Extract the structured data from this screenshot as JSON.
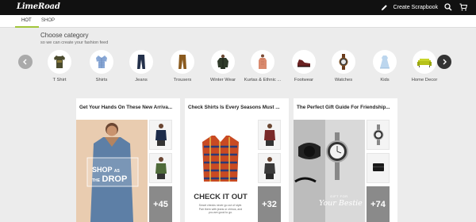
{
  "app": {
    "logo": "LimeRoad"
  },
  "topbar": {
    "create_label": "Create Scrapbook"
  },
  "tabs": [
    {
      "label": "HOT"
    },
    {
      "label": "SHOP"
    }
  ],
  "category": {
    "title": "Choose category",
    "subtitle": "so we can create your fashion feed",
    "items": [
      {
        "label": "T Shirt"
      },
      {
        "label": "Shirts"
      },
      {
        "label": "Jeans"
      },
      {
        "label": "Trousers"
      },
      {
        "label": "Winter Wear"
      },
      {
        "label": "Kurtas & Ethnic ..."
      },
      {
        "label": "Footwear"
      },
      {
        "label": "Watches"
      },
      {
        "label": "Kids"
      },
      {
        "label": "Home Decor"
      }
    ]
  },
  "cards": [
    {
      "title": "Get Your Hands On These New Arriva...",
      "main_text": "SHOP",
      "main_text2": "DROP",
      "main_small": "AS",
      "main_small2": "THE",
      "more": "+45"
    },
    {
      "title": "Check Shirts Is Every Seasons Must ...",
      "main_text": "CHECK IT OUT",
      "main_small": "Smart checks never go out of style. Pair them with jeans or chinos, and you are good to go.",
      "more": "+32"
    },
    {
      "title": "The Perfect Gift Guide For Friendship...",
      "main_text": "Your Bestie",
      "main_small": "GIFT FOR",
      "more": "+74"
    }
  ],
  "colors": {
    "accent": "#a2c53b",
    "topbar": "#111111"
  }
}
